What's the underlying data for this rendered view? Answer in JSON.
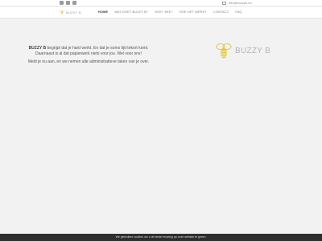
{
  "topbar": {
    "social": [
      "facebook-icon",
      "phone-icon",
      "instagram-icon"
    ],
    "email": "info@buzzyb.eu"
  },
  "header": {
    "logo_text": "BUZZY B"
  },
  "nav": {
    "items": [
      {
        "label": "Home",
        "active": true
      },
      {
        "label": "Wat doet Buzzy B?",
        "active": false
      },
      {
        "label": "Hoe? Wie?",
        "active": false
      },
      {
        "label": "Hoe het werkt",
        "active": false
      },
      {
        "label": "Contact",
        "active": false
      },
      {
        "label": "FAQ",
        "active": false
      }
    ]
  },
  "main": {
    "brand": "BUZZY B",
    "line1_rest": " begrijpt dat je hard werkt. En dat je soms tijd tekort komt.",
    "line2": "Daarnaast is al dat papierwerk niets voor jou. Wel voor ons!",
    "line3": "Meld je nu aan, en we nemen alle administratieve taken van je over."
  },
  "big_logo": {
    "text": "BUZZY B"
  },
  "cookie": {
    "text": "We gebruiken cookies om u de beste ervaring op onze website te geven."
  },
  "colors": {
    "accent": "#e2c84a",
    "background": "#f2f2f2",
    "cookie_bar": "#2e2e2e"
  }
}
